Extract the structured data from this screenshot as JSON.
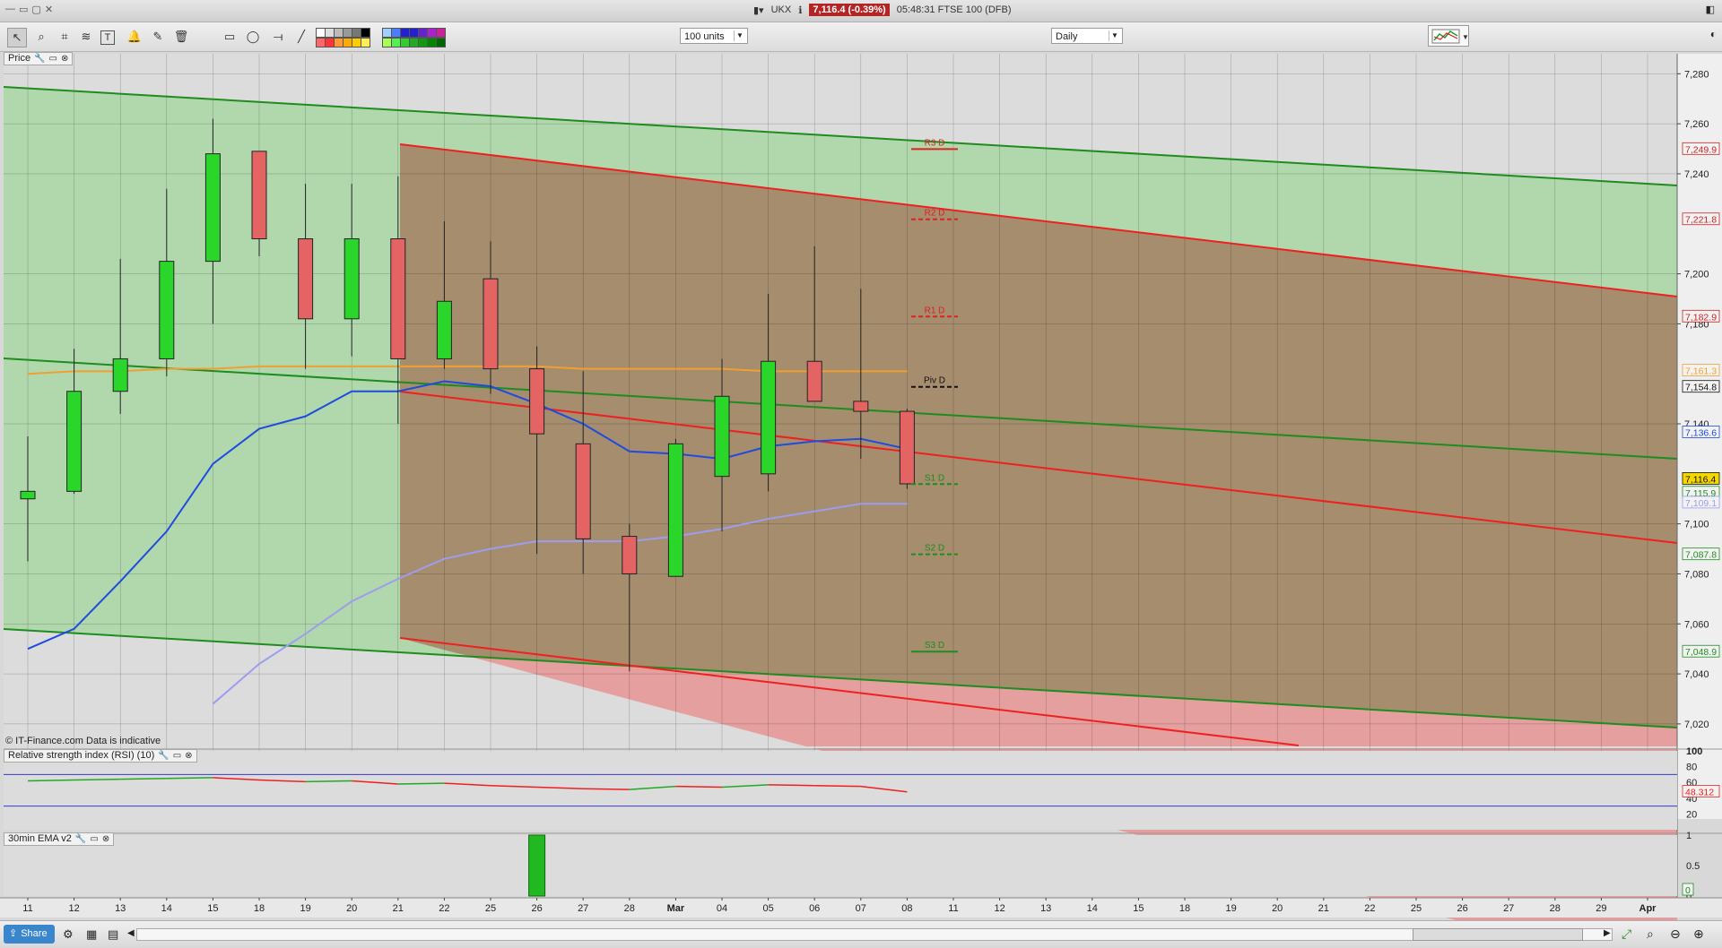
{
  "window": {
    "ticker_symbol": "UKX",
    "price_badge": "7,116.4 (-0.39%)",
    "time_label": "05:48:31 FTSE 100 (DFB)"
  },
  "toolbar": {
    "units_select": "100 units",
    "interval_select": "Daily",
    "text_tool": "T"
  },
  "panels": {
    "price": {
      "label": "Price"
    },
    "rsi": {
      "label": "Relative strength index (RSI) (10)"
    },
    "ema": {
      "label": "30min EMA v2"
    }
  },
  "copyright": "© IT-Finance.com  Data is indicative",
  "share_label": "Share",
  "colors": {
    "up": "#2bd62b",
    "down": "#e46464",
    "trend_green": "#1e8c1e",
    "trend_red": "#ee2020",
    "ma_blue": "#1e4be0",
    "ma_lavender": "#9d9df0",
    "ma_orange": "#f0a030"
  },
  "chart_data": {
    "type": "candlestick",
    "x_labels": [
      "11",
      "12",
      "13",
      "14",
      "15",
      "18",
      "19",
      "20",
      "21",
      "22",
      "25",
      "26",
      "27",
      "28",
      "Mar",
      "04",
      "05",
      "06",
      "07",
      "08",
      "11",
      "12",
      "13",
      "14",
      "15",
      "18",
      "19",
      "20",
      "21",
      "22",
      "25",
      "26",
      "27",
      "28",
      "29",
      "Apr"
    ],
    "candles": [
      {
        "o": 7110,
        "h": 7135,
        "l": 7085,
        "c": 7113
      },
      {
        "o": 7113,
        "h": 7170,
        "l": 7112,
        "c": 7153
      },
      {
        "o": 7153,
        "h": 7206,
        "l": 7144,
        "c": 7166
      },
      {
        "o": 7166,
        "h": 7234,
        "l": 7159,
        "c": 7205
      },
      {
        "o": 7205,
        "h": 7262,
        "l": 7180,
        "c": 7248
      },
      {
        "o": 7249,
        "h": 7249,
        "l": 7207,
        "c": 7214
      },
      {
        "o": 7214,
        "h": 7236,
        "l": 7162,
        "c": 7182
      },
      {
        "o": 7182,
        "h": 7236,
        "l": 7167,
        "c": 7214
      },
      {
        "o": 7214,
        "h": 7239,
        "l": 7140,
        "c": 7166
      },
      {
        "o": 7166,
        "h": 7221,
        "l": 7162,
        "c": 7189
      },
      {
        "o": 7198,
        "h": 7213,
        "l": 7152,
        "c": 7162
      },
      {
        "o": 7162,
        "h": 7171,
        "l": 7088,
        "c": 7136
      },
      {
        "o": 7132,
        "h": 7161,
        "l": 7080,
        "c": 7094
      },
      {
        "o": 7095,
        "h": 7100,
        "l": 7041,
        "c": 7080
      },
      {
        "o": 7079,
        "h": 7134,
        "l": 7079,
        "c": 7132
      },
      {
        "o": 7119,
        "h": 7166,
        "l": 7097,
        "c": 7151
      },
      {
        "o": 7120,
        "h": 7192,
        "l": 7113,
        "c": 7165
      },
      {
        "o": 7165,
        "h": 7211,
        "l": 7150,
        "c": 7149
      },
      {
        "o": 7149,
        "h": 7194,
        "l": 7126,
        "c": 7145
      },
      {
        "o": 7145,
        "h": 7146,
        "l": 7114,
        "c": 7116
      }
    ],
    "y_ticks": [
      "7,280",
      "7,260",
      "7,240",
      "7,200",
      "7,180",
      "7,140",
      "7,100",
      "7,080",
      "7,060",
      "7,040",
      "7,020"
    ],
    "ylim": [
      7011,
      7288
    ],
    "pivots": [
      {
        "label": "R3 D",
        "value": 7249.9,
        "style": "red-solid"
      },
      {
        "label": "R2 D",
        "value": 7221.8,
        "style": "red-dash"
      },
      {
        "label": "R1 D",
        "value": 7182.9,
        "style": "red-dash"
      },
      {
        "label": "Piv D",
        "value": 7154.8,
        "style": "black-dash"
      },
      {
        "label": "S1 D",
        "value": 7115.9,
        "style": "green-dash"
      },
      {
        "label": "S2 D",
        "value": 7087.8,
        "style": "green-dash"
      },
      {
        "label": "S3 D",
        "value": 7048.9,
        "style": "green-solid"
      }
    ],
    "price_badges": [
      {
        "text": "7,249.9",
        "value": 7249.9,
        "bg": "#f2f2f2",
        "fg": "#cc2222"
      },
      {
        "text": "7,221.8",
        "value": 7221.8,
        "bg": "#f2f2f2",
        "fg": "#cc2222"
      },
      {
        "text": "7,182.9",
        "value": 7182.9,
        "bg": "#f2f2f2",
        "fg": "#cc2222"
      },
      {
        "text": "7,161.3",
        "value": 7161.3,
        "bg": "#f2f2f2",
        "fg": "#f0a030"
      },
      {
        "text": "7,154.8",
        "value": 7154.8,
        "bg": "#f2f2f2",
        "fg": "#111111"
      },
      {
        "text": "7,136.6",
        "value": 7136.6,
        "bg": "#f2f2f2",
        "fg": "#1e4be0"
      },
      {
        "text": "7,116.4",
        "value": 7118.0,
        "bg": "#f5d800",
        "fg": "#111111"
      },
      {
        "text": "7,115.9",
        "value": 7112.5,
        "bg": "#f2f2f2",
        "fg": "#1e8c1e"
      },
      {
        "text": "7,109.1",
        "value": 7108.5,
        "bg": "#f2f2f2",
        "fg": "#9d9df0"
      },
      {
        "text": "7,087.8",
        "value": 7087.8,
        "bg": "#f2f2f2",
        "fg": "#1e8c1e"
      },
      {
        "text": "7,048.9",
        "value": 7048.9,
        "bg": "#f2f2f2",
        "fg": "#1e8c1e"
      }
    ],
    "ma_blue": [
      7050,
      7058,
      7077,
      7097,
      7124,
      7138,
      7143,
      7153,
      7153,
      7157,
      7155,
      7148,
      7140,
      7129,
      7128,
      7126,
      7131,
      7133,
      7134,
      7130
    ],
    "ma_lavender": [
      null,
      null,
      null,
      null,
      7028,
      7044,
      7056,
      7069,
      7078,
      7086,
      7090,
      7093,
      7093,
      7093,
      7095,
      7098,
      7102,
      7105,
      7108,
      7108
    ],
    "ma_orange": [
      7160,
      7161,
      7161,
      7162,
      7162,
      7163,
      7163,
      7163,
      7163,
      7163,
      7163,
      7163,
      7162,
      7162,
      7162,
      7162,
      7161,
      7161,
      7161,
      7161
    ],
    "rsi": {
      "y_ticks": [
        "100",
        "80",
        "60",
        "40",
        "20"
      ],
      "values": [
        62,
        63,
        64,
        65,
        66,
        63,
        61,
        62,
        58,
        59,
        56,
        54,
        52,
        51,
        55,
        54,
        57,
        56,
        55,
        48
      ],
      "last_label": "48.312",
      "overbought": 70,
      "oversold": 30
    },
    "ema": {
      "y_ticks": [
        "1",
        "0.5",
        "0"
      ],
      "last_label": "0",
      "values": [
        0,
        0,
        0,
        0,
        0,
        0,
        0,
        0,
        0,
        0,
        0,
        1,
        0,
        0,
        0,
        0,
        0,
        0,
        0,
        0
      ]
    }
  }
}
